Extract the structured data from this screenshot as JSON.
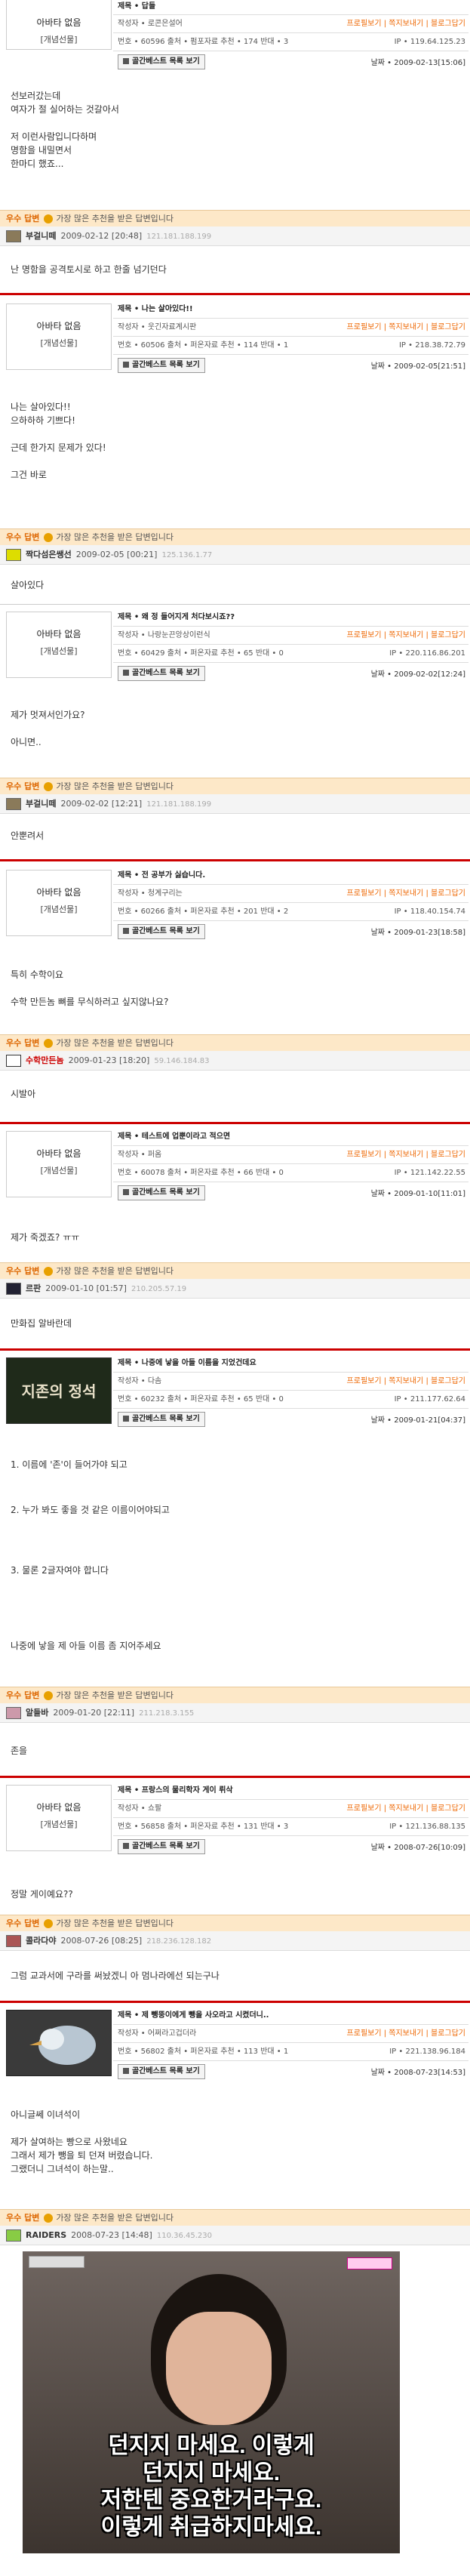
{
  "common": {
    "nick": "아바타 없음",
    "level": "[개념선물]",
    "btn": "골간베스트 목록 보기",
    "links": "프로필보기 | 쪽지보내기 | 블로그답기",
    "hint": "가장 많은 추천을 받은 답변입니다",
    "ans": "우수 답변"
  },
  "p1": {
    "title": "제목 • 답들",
    "author": "작성자 • 로콘은설어",
    "meta": "번호 • 60596   출처 • 펌포자료 추천 • 174   반대 • 3",
    "ip": "IP • 119.64.125.23",
    "date": "날짜 • 2009-02-13[15:06]",
    "body": [
      "선보러갔는데",
      "여자가 절 실어하는 것갈아서",
      "",
      "저 이런사람입니다하며",
      "명함을 내밀면서",
      "한마디 했죠..."
    ]
  },
  "r1": {
    "nick": "부걸니떼",
    "date": "2009-02-12 [20:48]",
    "ip": "121.181.188.199",
    "text": "난 명함을 공격토시로 하고 한줄 넘기던다"
  },
  "p2": {
    "title": "제목 • 나는 살아있다!!",
    "author": "작성자 • 웃긴자료계시판",
    "meta": "번호 • 60506   출처 • 퍼온자료 추천 • 114   반대 • 1",
    "ip": "IP • 218.38.72.79",
    "date": "날짜 • 2009-02-05[21:51]",
    "body": [
      "나는 살아있다!!",
      "으하하하 기쁘다!",
      "",
      "근데 한가지 문제가 있다!",
      "",
      "그건 바로"
    ]
  },
  "r2": {
    "nick": "짝다섬은쌩선",
    "date": "2009-02-05 [00:21]",
    "ip": "125.136.1.77",
    "text": "살아있다"
  },
  "p3": {
    "title": "제목 • 왜 정 들어지게 처다보시죠??",
    "author": "작성자 • 나랑눈끈앙상이런식",
    "meta": "번호 • 60429   출처 • 퍼온자료 추천 • 65   반대 • 0",
    "ip": "IP • 220.116.86.201",
    "date": "날짜 • 2009-02-02[12:24]",
    "body": [
      "제가 멋져서인가요?",
      "",
      "아니면.."
    ]
  },
  "r3": {
    "nick": "부걸니떼",
    "date": "2009-02-02 [12:21]",
    "ip": "121.181.188.199",
    "text": "안뿐려서"
  },
  "p4": {
    "title": "제목 • 전 공부가 싫습니다.",
    "author": "작성자 • 청계구리는",
    "meta": "번호 • 60266   출처 • 퍼온자료 추천 • 201   반대 • 2",
    "ip": "IP • 118.40.154.74",
    "date": "날짜 • 2009-01-23[18:58]",
    "body": [
      "특히 수학이요",
      "",
      "수학 만든놈 뼈를 무식하러고 싶지않나요?"
    ]
  },
  "r4": {
    "nick": "수학만든놈",
    "date": "2009-01-23 [18:20]",
    "ip": "59.146.184.83",
    "text": "시발아"
  },
  "p5": {
    "title": "제목 • 테스트에 업뿐이라고 적으면",
    "author": "작성자 • 퍼옴",
    "meta": "번호 • 60078   출처 • 퍼온자료 추천 • 66   반대 • 0",
    "ip": "IP • 121.142.22.55",
    "date": "날짜 • 2009-01-10[11:01]",
    "body": [
      "제가 죽겠죠? ㅠㅠ"
    ]
  },
  "r5": {
    "nick": "르판",
    "date": "2009-01-10 [01:57]",
    "ip": "210.205.57.19",
    "text": "만화집 알바란데"
  },
  "p6": {
    "title": "제목 • 나중에 낳을 아들 이름을 지었건데요",
    "author": "작성자 • 다솜",
    "meta": "번호 • 60232   출처 • 퍼온자료 추천 • 65   반대 • 0",
    "ip": "IP • 211.177.62.64",
    "date": "날짜 • 2009-01-21[04:37]",
    "avatar_text": "지존의 정석",
    "body": [
      "1. 이름에 '존'이 들어가야 되고",
      "",
      "",
      "2. 누가 봐도 좋을 것 같은 이름이어야되고",
      "",
      "",
      "",
      "3. 물론 2글자여야 합니다",
      "",
      "",
      "",
      "",
      "나중에 낳을 제 아들 이름 좀 지어주세요"
    ]
  },
  "r6": {
    "nick": "알들바",
    "date": "2009-01-20 [22:11]",
    "ip": "211.218.3.155",
    "text": "존을"
  },
  "p7": {
    "title": "제목 • 프랑스의 물리학자 게이 뤼삭",
    "author": "작성자 • 쇼팔",
    "meta": "번호 • 56858   출처 • 퍼온자료 추천 • 131   반대 • 3",
    "ip": "IP • 121.136.88.135",
    "date": "날짜 • 2008-07-26[10:09]",
    "body": [
      "정말 게이예요??"
    ]
  },
  "r7": {
    "nick": "콜라다야",
    "date": "2008-07-26 [08:25]",
    "ip": "218.236.128.182",
    "text": "그럼 교과서에 구라를 써놨겠니 아 멈나라에선 되는구나"
  },
  "p8": {
    "title": "제목 • 제 뺑뚱이에게 뺑을 사오라고 시켰더니..",
    "author": "작성자 • 어쩌라고겁더라",
    "meta": "번호 • 56802   출처 • 퍼온자료 추천 • 113   반대 • 1",
    "ip": "IP • 221.138.96.184",
    "date": "날짜 • 2008-07-23[14:53]",
    "body": [
      "아니글쎄 이녀석이",
      "",
      "제가 살여하는 빵으로 사왔네요",
      "그래서 제가 뺑을 퇴 던져 버렸습니다.",
      "그랬더니 그녀석이 하는말.."
    ]
  },
  "r8": {
    "nick": "RAIDERS",
    "date": "2008-07-23 [14:48]",
    "ip": "110.36.45.230",
    "cap1": "던지지 마세요. 이렇게",
    "cap2": "던지지 마세요.",
    "cap3": "저한텐 중요한거라구요.",
    "cap4": "이렇게 취급하지마세요."
  }
}
